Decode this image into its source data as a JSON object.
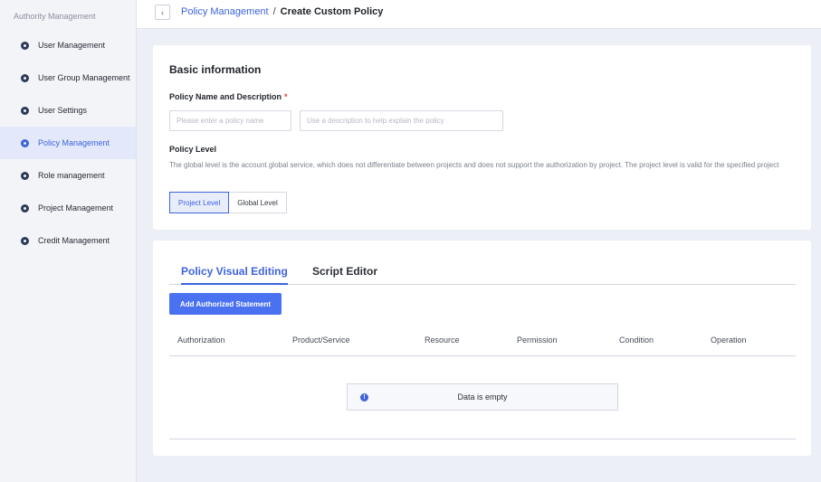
{
  "sidebar": {
    "title": "Authority Management",
    "items": [
      {
        "label": "User Management"
      },
      {
        "label": "User Group Management"
      },
      {
        "label": "User Settings"
      },
      {
        "label": "Policy Management",
        "active": true
      },
      {
        "label": "Role management"
      },
      {
        "label": "Project Management"
      },
      {
        "label": "Credit Management"
      }
    ]
  },
  "header": {
    "back_icon": "‹",
    "breadcrumb_link": "Policy Management",
    "breadcrumb_sep": "/",
    "breadcrumb_current": "Create Custom Policy"
  },
  "basic": {
    "title": "Basic information",
    "name_label": "Policy Name and Description",
    "required_mark": "*",
    "name_placeholder": "Please enter a policy name",
    "desc_placeholder": "Use a description to help explain the policy",
    "level_label": "Policy Level",
    "level_description": "The global level is the account global service, which does not differentiate between projects and does not support the authorization by project. The project level is valid for the specified project",
    "levels": [
      {
        "label": "Project Level",
        "selected": true
      },
      {
        "label": "Global Level",
        "selected": false
      }
    ]
  },
  "editor": {
    "tabs": [
      {
        "label": "Policy Visual Editing",
        "active": true
      },
      {
        "label": "Script Editor",
        "active": false
      }
    ],
    "add_button": "Add Authorized Statement",
    "columns": [
      "Authorization",
      "Product/Service",
      "Resource",
      "Permission",
      "Condition",
      "Operation"
    ],
    "empty_icon": "!",
    "empty_text": "Data is empty"
  },
  "colors": {
    "accent": "#3d63dd",
    "button": "#4a72f0",
    "required": "#e23b3b"
  }
}
